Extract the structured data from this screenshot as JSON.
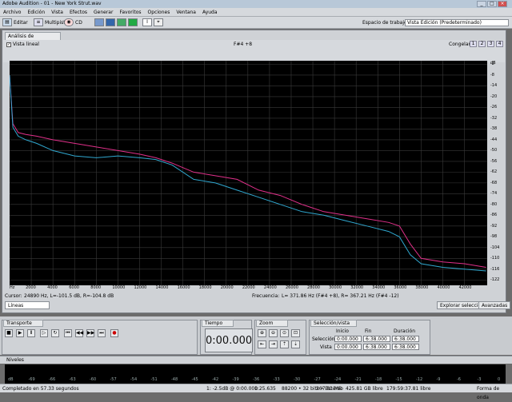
{
  "window": {
    "title": "Adobe Audition - 01 - New York Strut.wav",
    "minimize": "_",
    "maximize": "□",
    "close": "×"
  },
  "menu": [
    "Archivo",
    "Edición",
    "Vista",
    "Efectos",
    "Generar",
    "Favoritos",
    "Opciones",
    "Ventana",
    "Ayuda"
  ],
  "toolbar": {
    "edit_label": "Editar",
    "multitrack_label": "Multipista",
    "cd_label": "CD",
    "workspace_label": "Espacio de trabajo:",
    "workspace_value": "Vista Edición (Predeterminado)"
  },
  "panel": {
    "tab_label": "Análisis de frecuencia",
    "linear_view_label": "Vista lineal",
    "note_label": "F#4 +8",
    "freeze_label": "Congelar:",
    "freeze_buttons": [
      "1",
      "2",
      "3",
      "4"
    ],
    "cursor_label": "Cursor:",
    "cursor_value": "24890 Hz, L=-101.5 dB, R=-104.8 dB",
    "frequency_label": "Frecuencia:",
    "frequency_value": "L= 371.86 Hz (F#4 +8), R= 367.21 Hz (F#4 -12)",
    "explore_button": "Explorar selección",
    "advanced_button": "Avanzadas",
    "display_select": "Líneas"
  },
  "chart_data": {
    "type": "line",
    "xlabel": "",
    "ylabel": "",
    "x_unit": "Hz",
    "xlim": [
      0,
      44100
    ],
    "ylim": [
      -125,
      0
    ],
    "x_ticks": [
      "2000",
      "4000",
      "6000",
      "8000",
      "10000",
      "12000",
      "14000",
      "16000",
      "18000",
      "20000",
      "22000",
      "24000",
      "26000",
      "28000",
      "30000",
      "32000",
      "34000",
      "36000",
      "38000",
      "40000",
      "42000"
    ],
    "y_ticks": [
      "-2",
      "-8",
      "-14",
      "-20",
      "-26",
      "-32",
      "-38",
      "-44",
      "-50",
      "-56",
      "-62",
      "-68",
      "-74",
      "-80",
      "-86",
      "-92",
      "-98",
      "-104",
      "-110",
      "-116",
      "-122"
    ],
    "y_unit": "dB",
    "grid": true,
    "series": [
      {
        "name": "L",
        "color": "#e0308a",
        "x": [
          0,
          300,
          800,
          1500,
          2500,
          4000,
          6000,
          8000,
          10000,
          12000,
          13500,
          15000,
          17000,
          19000,
          21000,
          23000,
          25000,
          27000,
          29000,
          31000,
          33000,
          35000,
          36000,
          37000,
          38000,
          40000,
          42000,
          44000
        ],
        "values": [
          -8,
          -35,
          -40,
          -41,
          -42,
          -44,
          -46,
          -48,
          -50,
          -52,
          -54,
          -57,
          -62,
          -64,
          -66,
          -72,
          -75,
          -80,
          -84,
          -86,
          -88,
          -90,
          -92,
          -102,
          -110,
          -112,
          -113,
          -115
        ]
      },
      {
        "name": "R",
        "color": "#30a8d0",
        "x": [
          0,
          300,
          800,
          1500,
          2500,
          4000,
          6000,
          8000,
          10000,
          12000,
          13500,
          15000,
          17000,
          19000,
          21000,
          23000,
          25000,
          27000,
          29000,
          31000,
          33000,
          35000,
          36000,
          37000,
          38000,
          40000,
          42000,
          44000
        ],
        "values": [
          -8,
          -37,
          -42,
          -44,
          -46,
          -50,
          -53,
          -54,
          -53,
          -54,
          -55,
          -58,
          -66,
          -68,
          -72,
          -76,
          -80,
          -84,
          -86,
          -89,
          -92,
          -95,
          -98,
          -108,
          -113,
          -115,
          -116,
          -117
        ]
      }
    ]
  },
  "transport": {
    "tab_label": "Transporte"
  },
  "time": {
    "tab_label": "Tiempo",
    "value": "0:00.000"
  },
  "zoom": {
    "tab_label": "Zoom"
  },
  "selection": {
    "tab_label": "Selección/vista",
    "headers": [
      "Inicio",
      "Fin",
      "Duración"
    ],
    "rows": [
      {
        "label": "Selección",
        "start": "0:00.000",
        "end": "6:38.000",
        "dur": "6:38.000"
      },
      {
        "label": "Vista",
        "start": "0:00.000",
        "end": "6:38.000",
        "dur": "6:38.000"
      }
    ]
  },
  "levels": {
    "tab_label": "Niveles",
    "scale": [
      "dB",
      "-69",
      "-66",
      "-63",
      "-60",
      "-57",
      "-54",
      "-51",
      "-48",
      "-45",
      "-42",
      "-39",
      "-36",
      "-33",
      "-30",
      "-27",
      "-24",
      "-21",
      "-18",
      "-15",
      "-12",
      "-9",
      "-6",
      "-3",
      "0"
    ]
  },
  "statusbar": {
    "left": "Completado en 57.33 segundos",
    "level": "1: -2.5dB @ 0:00.000",
    "time": "1:25.635",
    "format": "88200 • 32 bits • Estéreo",
    "size": "267.81 MB",
    "free": "425.81 GB libre",
    "free_time": "179:59:37.81 libre",
    "view": "Forma de onda"
  }
}
